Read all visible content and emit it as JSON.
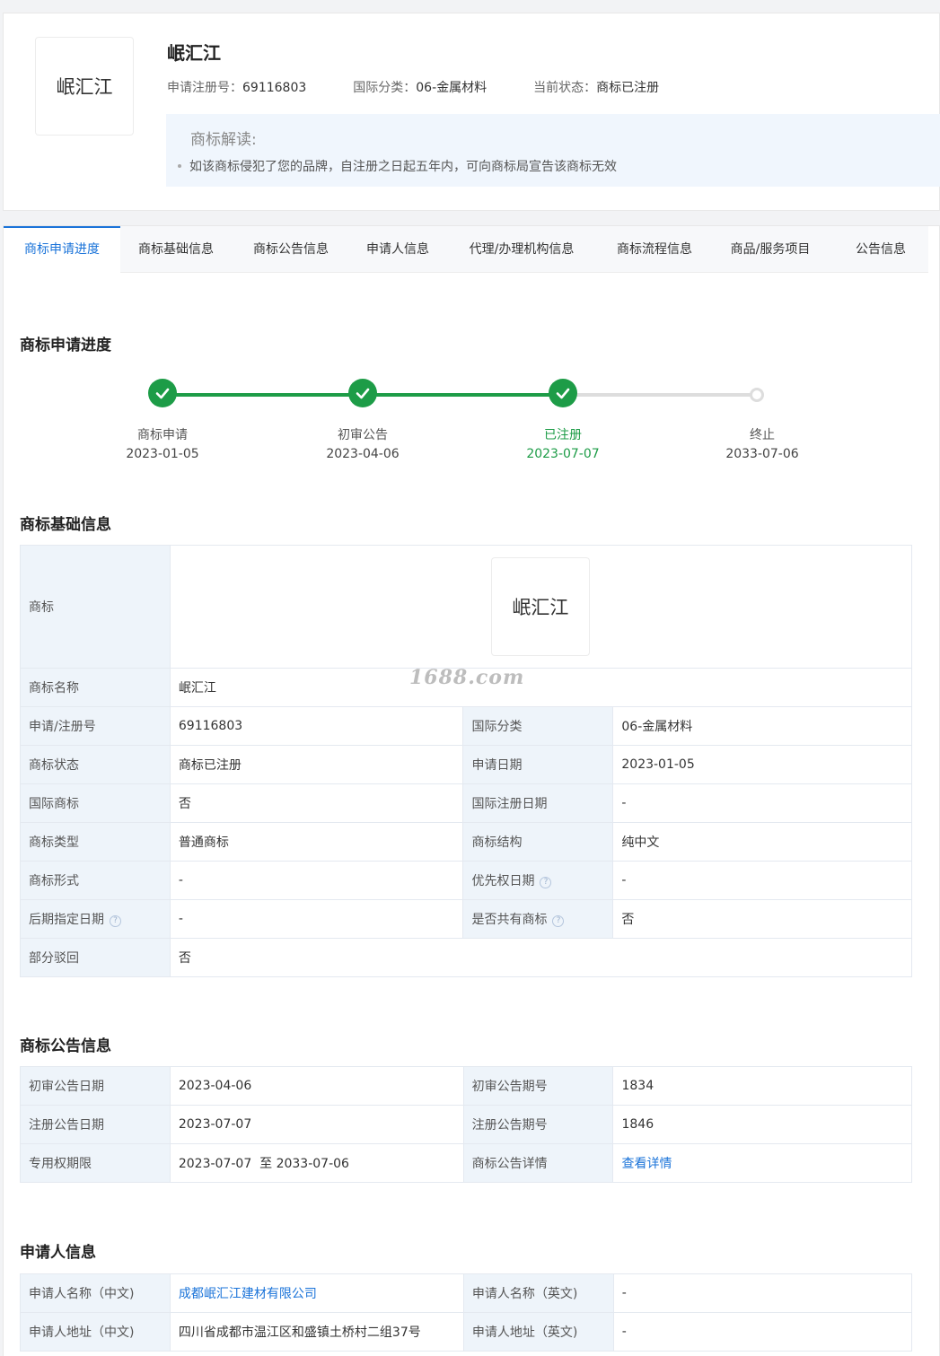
{
  "header": {
    "logo_text": "岷汇江",
    "title": "岷汇江",
    "meta": [
      {
        "label": "申请注册号：",
        "value": "69116803"
      },
      {
        "label": "国际分类：",
        "value": "06-金属材料"
      },
      {
        "label": "当前状态：",
        "value": "商标已注册"
      }
    ],
    "interp_title": "商标解读:",
    "interp_item": "如该商标侵犯了您的品牌，自注册之日起五年内，可向商标局宣告该商标无效"
  },
  "tabs": [
    "商标申请进度",
    "商标基础信息",
    "商标公告信息",
    "申请人信息",
    "代理/办理机构信息",
    "商标流程信息",
    "商品/服务项目",
    "公告信息"
  ],
  "progress": {
    "title": "商标申请进度",
    "steps": [
      {
        "label": "商标申请",
        "date": "2023-01-05",
        "status": "done"
      },
      {
        "label": "初审公告",
        "date": "2023-04-06",
        "status": "done"
      },
      {
        "label": "已注册",
        "date": "2023-07-07",
        "status": "current"
      },
      {
        "label": "终止",
        "date": "2033-07-06",
        "status": "pending"
      }
    ],
    "colors": {
      "done": "#1d9c47",
      "pending": "#dddddd"
    }
  },
  "basic": {
    "title": "商标基础信息",
    "mark_label": "商标",
    "mark_text": "岷汇江",
    "name_label": "商标名称",
    "name_value": "岷汇江",
    "rows": [
      {
        "k1": "申请/注册号",
        "v1": "69116803",
        "k2": "国际分类",
        "v2": "06-金属材料"
      },
      {
        "k1": "商标状态",
        "v1": "商标已注册",
        "k2": "申请日期",
        "v2": "2023-01-05"
      },
      {
        "k1": "国际商标",
        "v1": "否",
        "k2": "国际注册日期",
        "v2": "-"
      },
      {
        "k1": "商标类型",
        "v1": "普通商标",
        "k2": "商标结构",
        "v2": "纯中文"
      },
      {
        "k1": "商标形式",
        "v1": "-",
        "k2": "优先权日期",
        "v2": "-"
      },
      {
        "k1": "后期指定日期",
        "v1": "-",
        "k2": "是否共有商标",
        "v2": "否"
      }
    ],
    "last_label": "部分驳回",
    "last_value": "否",
    "help_glyph": "?"
  },
  "watermark": "1688.com",
  "announce": {
    "title": "商标公告信息",
    "rows": [
      {
        "k1": "初审公告日期",
        "v1": "2023-04-06",
        "k2": "初审公告期号",
        "v2": "1834"
      },
      {
        "k1": "注册公告日期",
        "v1": "2023-07-07",
        "k2": "注册公告期号",
        "v2": "1846"
      },
      {
        "k1": "专用权期限",
        "v1": "2023-07-07  至 2033-07-06",
        "k2": "商标公告详情",
        "v2": "查看详情"
      }
    ]
  },
  "applicant": {
    "title": "申请人信息",
    "rows": [
      {
        "k1": "申请人名称（中文)",
        "v1": "成都岷汇江建材有限公司",
        "k2": "申请人名称（英文)",
        "v2": "-"
      },
      {
        "k1": "申请人地址（中文)",
        "v1": "四川省成都市温江区和盛镇土桥村二组37号",
        "k2": "申请人地址（英文)",
        "v2": "-"
      }
    ]
  }
}
